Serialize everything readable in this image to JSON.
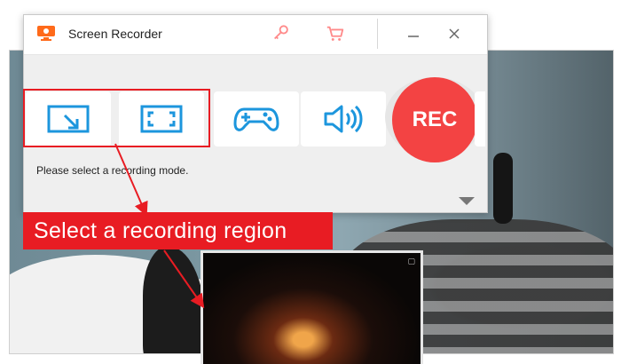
{
  "app": {
    "title": "Screen Recorder",
    "icons": [
      "app-logo-icon",
      "key-icon",
      "cart-icon",
      "minimize-icon",
      "close-icon"
    ]
  },
  "modes": [
    {
      "name": "custom-region",
      "icon": "region-select-icon"
    },
    {
      "name": "fullscreen",
      "icon": "fullscreen-icon"
    },
    {
      "name": "game",
      "icon": "gamepad-icon"
    },
    {
      "name": "audio",
      "icon": "speaker-icon"
    }
  ],
  "rec_button": {
    "label": "REC"
  },
  "status_text": "Please select a recording mode.",
  "annotation": {
    "callout": "Select a recording region"
  },
  "colors": {
    "accent_blue": "#1c96dd",
    "rec_red": "#f34343",
    "annotation_red": "#e81c23"
  }
}
